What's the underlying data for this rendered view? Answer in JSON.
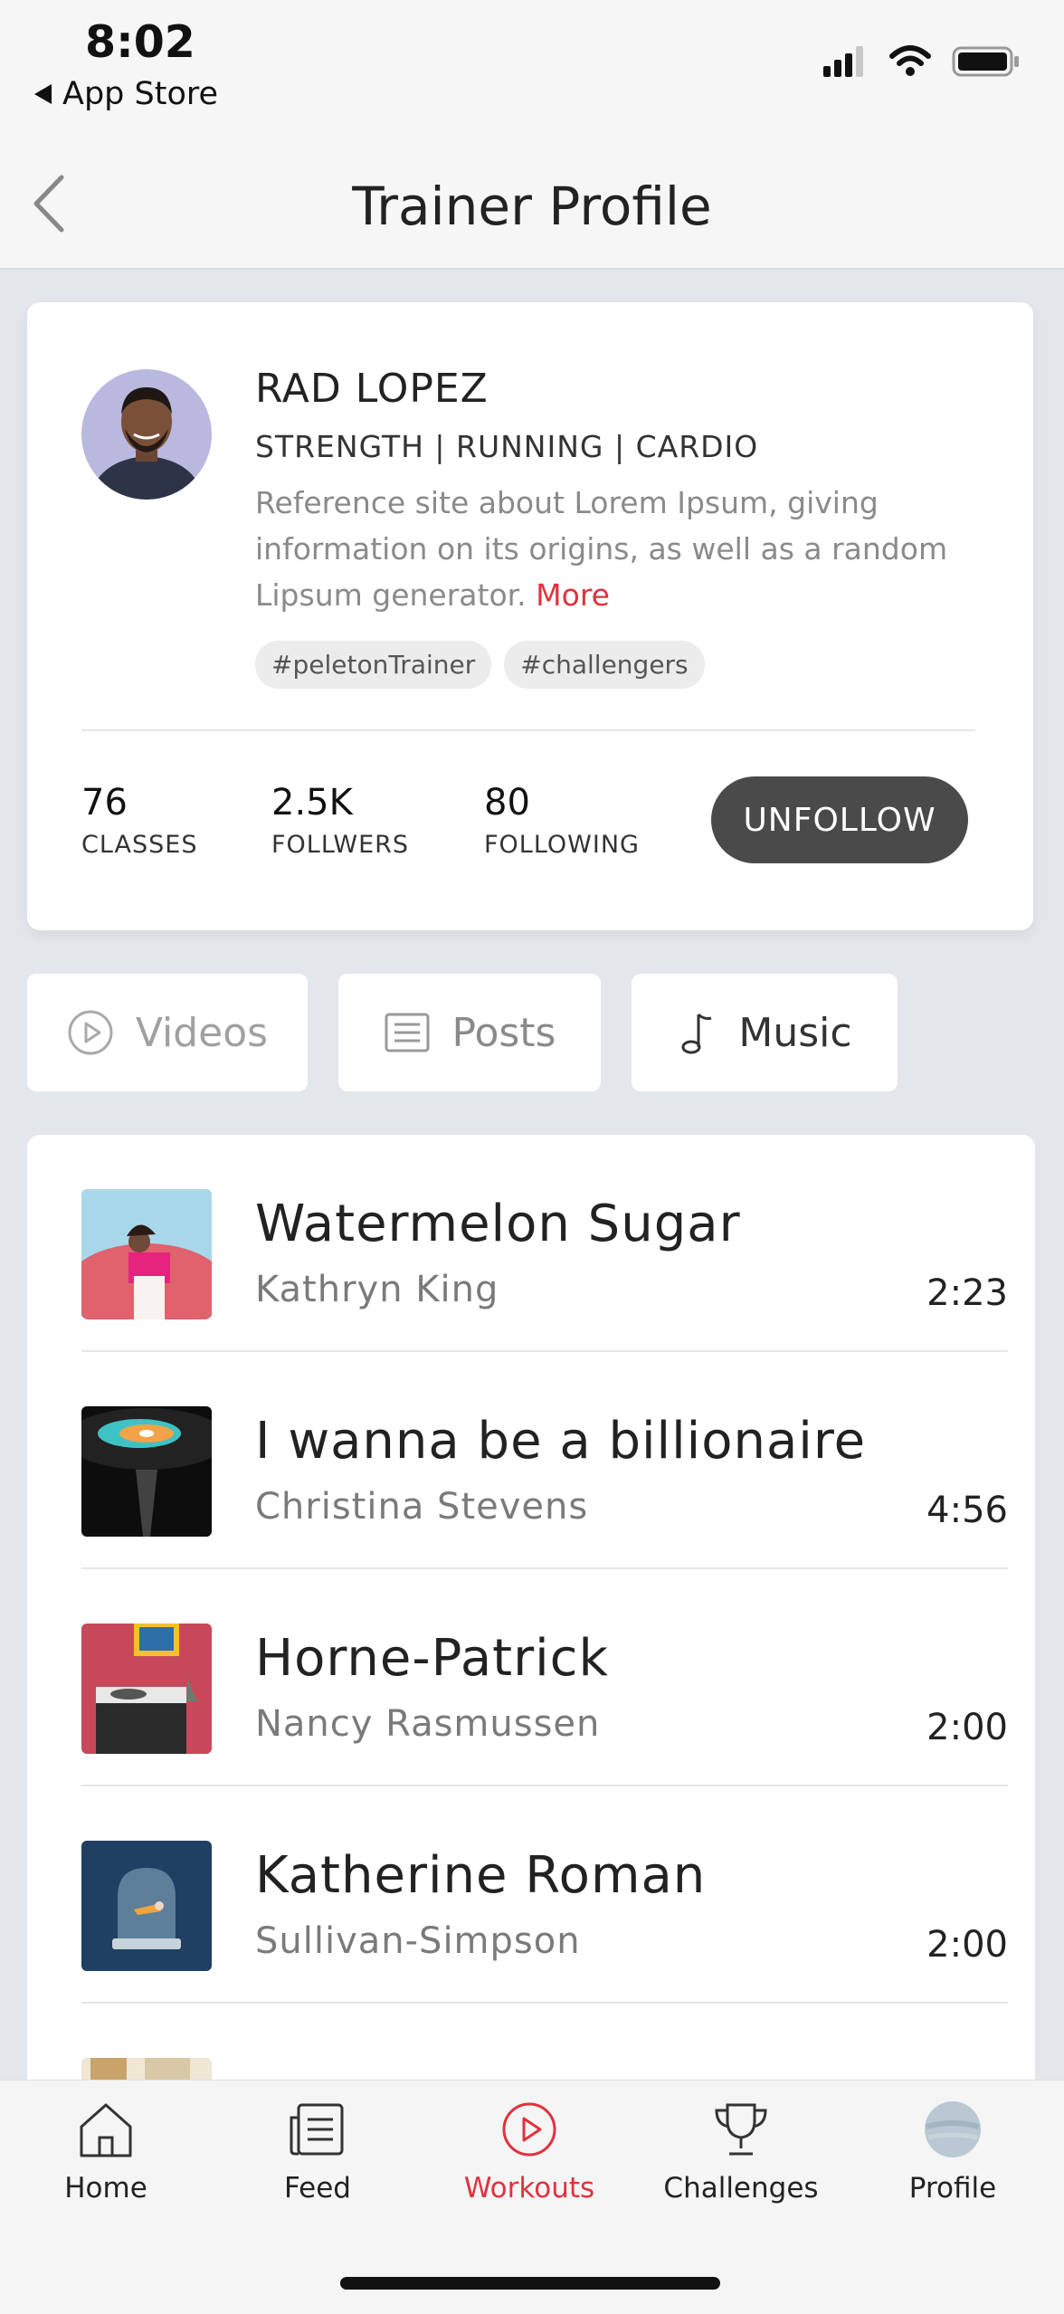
{
  "status_bar": {
    "time": "8:02",
    "back_app": "App Store"
  },
  "header": {
    "title": "Trainer Profile"
  },
  "trainer": {
    "name": "RAD LOPEZ",
    "disciplines": "STRENGTH | RUNNING | CARDIO",
    "bio": "Reference site about Lorem Ipsum, giving information on its origins, as well as a random Lipsum generator.",
    "more_label": "More",
    "hashtags": [
      "#peletonTrainer",
      "#challengers"
    ]
  },
  "stats": {
    "classes": {
      "value": "76",
      "label": "CLASSES"
    },
    "followers": {
      "value": "2.5K",
      "label": "FOLLWERS"
    },
    "following": {
      "value": "80",
      "label": "FOLLOWING"
    },
    "unfollow_label": "UNFOLLOW"
  },
  "tabs": [
    {
      "label": "Videos",
      "icon": "play-circle-icon",
      "active": false
    },
    {
      "label": "Posts",
      "icon": "document-icon",
      "active": false
    },
    {
      "label": "Music",
      "icon": "music-note-icon",
      "active": true
    }
  ],
  "songs": [
    {
      "title": "Watermelon Sugar",
      "artist": "Kathryn King",
      "duration": "2:23"
    },
    {
      "title": "I wanna be a billionaire",
      "artist": "Christina Stevens",
      "duration": "4:56"
    },
    {
      "title": "Horne-Patrick",
      "artist": "Nancy Rasmussen",
      "duration": "2:00"
    },
    {
      "title": "Katherine Roman",
      "artist": "Sullivan-Simpson",
      "duration": "2:00"
    }
  ],
  "bottom_nav": [
    {
      "label": "Home",
      "icon": "home-icon"
    },
    {
      "label": "Feed",
      "icon": "feed-icon"
    },
    {
      "label": "Workouts",
      "icon": "play-circle-icon",
      "active": true
    },
    {
      "label": "Challenges",
      "icon": "trophy-icon"
    },
    {
      "label": "Profile",
      "icon": "avatar"
    }
  ],
  "colors": {
    "accent": "#e0323e",
    "button_dark": "#4a4a4a",
    "background": "#e3e6ea"
  }
}
